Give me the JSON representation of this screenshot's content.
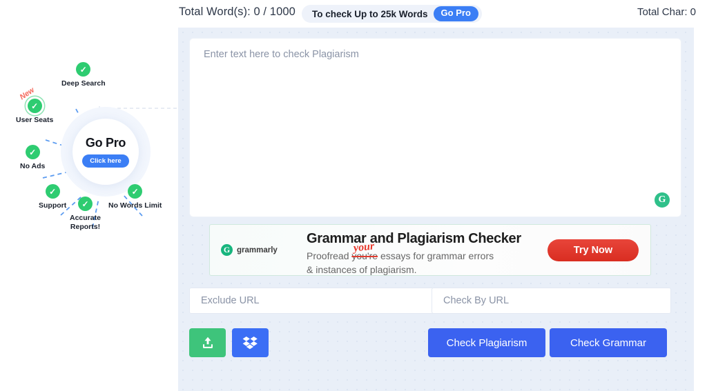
{
  "header": {
    "total_words_label": "Total Word(s): 0 / 1000",
    "upgrade_pill_text": "To check Up to 25k Words",
    "upgrade_pill_button": "Go Pro",
    "total_chars_label": "Total Char: 0"
  },
  "promo": {
    "center_title": "Go Pro",
    "center_button": "Click here",
    "new_badge": "New",
    "features": [
      {
        "label": "Deep Search"
      },
      {
        "label": "User Seats"
      },
      {
        "label": "No Ads"
      },
      {
        "label": "Support"
      },
      {
        "label": "Accurate\nReports!"
      },
      {
        "label": "No Words Limit"
      }
    ]
  },
  "editor": {
    "placeholder": "Enter text here to check Plagiarism",
    "value": "",
    "grammarly_badge": "G"
  },
  "ad": {
    "logo_mark": "G",
    "logo_text": "grammarly",
    "headline": "Grammar and Plagiarism Checker",
    "line1_prefix": "Proofread ",
    "line1_strike": "you're",
    "line1_suffix": " essays for grammar errors",
    "line2": "& instances of plagiarism.",
    "handwritten_correction": "your",
    "cta_label": "Try Now"
  },
  "urls": {
    "exclude_placeholder": "Exclude URL",
    "exclude_value": "",
    "check_placeholder": "Check By URL",
    "check_value": ""
  },
  "actions": {
    "upload_icon": "upload-icon",
    "dropbox_icon": "dropbox-icon",
    "check_plagiarism": "Check Plagiarism",
    "check_grammar": "Check Grammar"
  },
  "colors": {
    "accent_blue": "#3b62f5",
    "success_green": "#2ecc71",
    "panel_bg": "#e9eff8",
    "ad_red": "#d92d21",
    "grammarly_green": "#18b57e",
    "new_badge_red": "#f4695c"
  }
}
